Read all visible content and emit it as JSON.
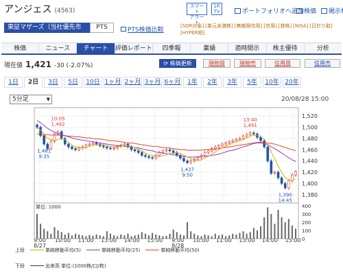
{
  "header": {
    "title": "アンジェス",
    "code": "(4563)",
    "smart_alert": [
      "スマート",
      "アラート"
    ],
    "tv": [
      "1R",
      "TV"
    ],
    "portfolio": "ポートフォリオへ追加",
    "board": "株価",
    "notice": "掲示板"
  },
  "market": {
    "label": "東証マザーズ（当社優先市場）",
    "pts": "PTS",
    "pts_compare": "PTS株価比較"
  },
  "tags": [
    "[SOR対象]",
    "[単元未満株]",
    "[無期限信用]",
    "[信用]",
    "[貸株]",
    "[NISA]",
    "[日計り取]",
    "[HYPER短]"
  ],
  "nav": [
    "株価",
    "ニュース",
    "チャート",
    "評価レポート",
    "四季報",
    "業績",
    "適時開示",
    "株主優待",
    "分析"
  ],
  "nav_active": 2,
  "price": {
    "label": "現在値",
    "value": "1,421",
    "change": "-30 (-2.07%)"
  },
  "actions": {
    "update": "株価更新",
    "buy": "現物買",
    "sell": "現物売",
    "margin_buy": "信用買",
    "margin_sell": "信用売"
  },
  "periods": [
    "1日",
    "2日",
    "3日",
    "5日",
    "10日",
    "1ヶ月",
    "2ヶ月",
    "3ヶ月",
    "6ヶ月",
    "1年",
    "2年",
    "3年",
    "5年",
    "10年",
    "20年"
  ],
  "period_active": 1,
  "interval": "5分足",
  "chart_date": "20/08/28 15:00",
  "colors": {
    "accent": "#2b4fa6",
    "up": "#e03a2f",
    "down": "#2255aa",
    "ma5": "#d4b000",
    "ma25": "#8b3fc0",
    "ma50": "#e8442d"
  },
  "chart_data": {
    "type": "line",
    "yticks": [
      "1,520",
      "1,500",
      "1,480",
      "1,460",
      "1,440",
      "1,420",
      "1,400",
      "1,380"
    ],
    "ylim": [
      1375,
      1525
    ],
    "xticks": [
      "9:00",
      "10:00",
      "11:00",
      "13:00",
      "14:00",
      "15:00",
      "9:00",
      "10:00",
      "11:00",
      "13:00",
      "14:00",
      "15:00"
    ],
    "day_labels": [
      "8/27",
      "8/28"
    ],
    "annotations": [
      {
        "time": "10:05",
        "price": "1,492",
        "kind": "high"
      },
      {
        "time": "9:35",
        "price": "1,461",
        "kind": "low"
      },
      {
        "time": "9:50",
        "price": "1,437",
        "kind": "low"
      },
      {
        "time": "13:40",
        "price": "1,491",
        "kind": "high"
      },
      {
        "time": "14:45",
        "price": "1,390",
        "kind": "low"
      }
    ],
    "close": [
      1500,
      1485,
      1470,
      1462,
      1475,
      1488,
      1492,
      1480,
      1470,
      1465,
      1462,
      1460,
      1463,
      1465,
      1468,
      1470,
      1472,
      1470,
      1467,
      1465,
      1463,
      1462,
      1463,
      1466,
      1468,
      1470,
      1465,
      1460,
      1458,
      1455,
      1450,
      1448,
      1446,
      1445,
      1450,
      1455,
      1458,
      1460,
      1458,
      1455,
      1450,
      1445,
      1440,
      1437,
      1440,
      1443,
      1446,
      1450,
      1455,
      1458,
      1462,
      1465,
      1467,
      1470,
      1472,
      1474,
      1476,
      1478,
      1480,
      1484,
      1487,
      1490,
      1488,
      1482,
      1476,
      1465,
      1440,
      1418,
      1420,
      1410,
      1400,
      1392,
      1405,
      1415,
      1421
    ],
    "ma5": [
      1500,
      1495,
      1488,
      1480,
      1478,
      1476,
      1478,
      1480,
      1478,
      1473,
      1468,
      1465,
      1464,
      1463,
      1464,
      1466,
      1468,
      1469,
      1469,
      1469,
      1467,
      1466,
      1465,
      1465,
      1466,
      1467,
      1467,
      1466,
      1464,
      1461,
      1458,
      1454,
      1451,
      1449,
      1448,
      1448,
      1449,
      1451,
      1453,
      1454,
      1455,
      1453,
      1450,
      1447,
      1444,
      1442,
      1441,
      1442,
      1445,
      1448,
      1452,
      1456,
      1460,
      1463,
      1466,
      1469,
      1472,
      1474,
      1476,
      1478,
      1481,
      1484,
      1486,
      1485,
      1483,
      1479,
      1469,
      1456,
      1444,
      1431,
      1420,
      1410,
      1406,
      1405,
      1408
    ],
    "ma25": [
      1512,
      1508,
      1503,
      1498,
      1494,
      1491,
      1489,
      1487,
      1485,
      1483,
      1481,
      1479,
      1478,
      1477,
      1476,
      1475,
      1474,
      1473,
      1472,
      1471,
      1470,
      1469,
      1468,
      1467,
      1467,
      1466,
      1466,
      1465,
      1464,
      1463,
      1462,
      1460,
      1459,
      1458,
      1456,
      1455,
      1454,
      1453,
      1452,
      1451,
      1450,
      1449,
      1448,
      1447,
      1447,
      1447,
      1447,
      1448,
      1448,
      1449,
      1450,
      1451,
      1452,
      1454,
      1456,
      1458,
      1459,
      1461,
      1463,
      1465,
      1467,
      1469,
      1471,
      1472,
      1472,
      1471,
      1469,
      1465,
      1462,
      1458,
      1454,
      1450,
      1446,
      1442,
      1439
    ],
    "ma50": [
      1488,
      1488,
      1487,
      1487,
      1486,
      1486,
      1486,
      1485,
      1485,
      1484,
      1484,
      1483,
      1483,
      1482,
      1481,
      1481,
      1480,
      1479,
      1479,
      1478,
      1477,
      1476,
      1476,
      1475,
      1474,
      1473,
      1472,
      1472,
      1471,
      1470,
      1469,
      1468,
      1467,
      1466,
      1466,
      1465,
      1464,
      1463,
      1463,
      1462,
      1461,
      1460,
      1460,
      1459,
      1459,
      1459,
      1459,
      1459,
      1460,
      1460,
      1461,
      1461,
      1462,
      1463,
      1464,
      1465,
      1466,
      1467,
      1468,
      1469,
      1470,
      1471,
      1472,
      1473,
      1473,
      1473,
      1472,
      1471,
      1470,
      1468,
      1466,
      1464,
      1462,
      1460,
      1458
    ],
    "volume_title": "単位: 1000",
    "volume_yticks": [
      "400",
      "300",
      "200",
      "100",
      "0"
    ],
    "volume_ylim": [
      0,
      400
    ],
    "volume": [
      300,
      180,
      120,
      90,
      60,
      140,
      100,
      80,
      50,
      70,
      40,
      60,
      50,
      40,
      30,
      45,
      35,
      50,
      40,
      30,
      90,
      60,
      40,
      30,
      50,
      40,
      60,
      30,
      40,
      50,
      80,
      60,
      40,
      70,
      50,
      40,
      30,
      35,
      60,
      110,
      80,
      50,
      40,
      200,
      90,
      60,
      40,
      30,
      50,
      40,
      30,
      60,
      40,
      50,
      30,
      40,
      60,
      50,
      70,
      90,
      60,
      80,
      130,
      100,
      150,
      260,
      380,
      300,
      180,
      350,
      260,
      200,
      240,
      160,
      120
    ]
  },
  "legends": [
    {
      "panel": "上段",
      "items": [
        "単純移動平均(5)",
        "単純移動平均(25)",
        "単純移動平均(50)"
      ]
    },
    {
      "panel": "下段",
      "items": [
        "出来高 単位:(1000株/口/枚)"
      ]
    }
  ]
}
